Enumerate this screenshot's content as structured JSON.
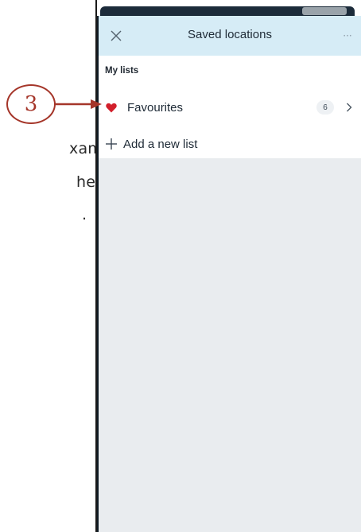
{
  "caption": {
    "lines": [
      "xample",
      "he",
      "."
    ]
  },
  "callout": {
    "number": "3",
    "color": "#a5362a"
  },
  "header": {
    "title": "Saved locations",
    "close_icon": "close-icon",
    "more_label": "···",
    "background": "#d6ecf6"
  },
  "lists": {
    "section_title": "My lists",
    "items": [
      {
        "icon": "heart-icon",
        "label": "Favourites",
        "count": "6",
        "icon_color": "#d21f2b"
      }
    ],
    "add": {
      "icon": "plus-icon",
      "label": "Add a new list"
    }
  },
  "colors": {
    "screen_background": "#e9ecef",
    "text": "#1e2a36"
  }
}
